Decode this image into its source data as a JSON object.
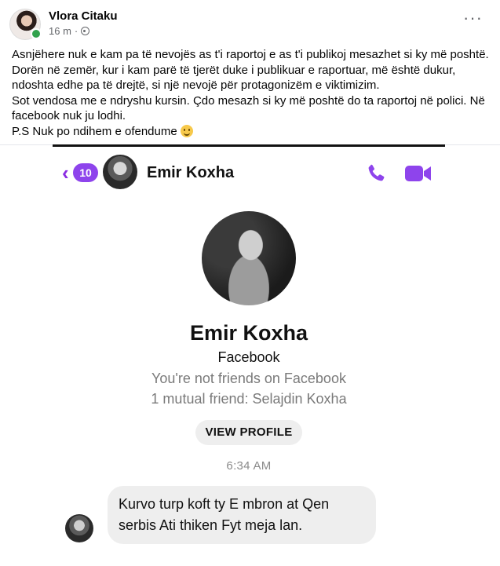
{
  "post": {
    "author": "Vlora Citaku",
    "time": "16 m",
    "separator": "·",
    "more_label": "···",
    "lines": [
      "Asnjëhere nuk e kam pa të nevojës as t'i raportoj e as t'i publikoj mesazhet si ky më poshtë.",
      "Dorën në zemër, kur i kam parë të tjerët duke i publikuar e raportuar, më është dukur, ndoshta edhe pa të drejtë, si një nevojë për protagonizëm e viktimizim.",
      "Sot vendosa me e ndryshu kursin. Çdo mesazh si ky më poshtë do ta raportoj në polici. Në facebook nuk ju lodhi."
    ],
    "ps_line": "P.S Nuk po ndihem e ofendume"
  },
  "messenger": {
    "back_count": "10",
    "contact_name": "Emir Koxha",
    "profile_name": "Emir Koxha",
    "profile_source": "Facebook",
    "friend_status": "You're not friends on Facebook",
    "mutual": "1 mutual friend: Selajdin Koxha",
    "view_profile": "VIEW PROFILE",
    "timestamp": "6:34 AM",
    "message": "Kurvo turp koft ty E mbron at Qen serbis Ati thiken Fyt meja lan."
  },
  "colors": {
    "accent": "#8e44ec",
    "online": "#31a24c"
  }
}
